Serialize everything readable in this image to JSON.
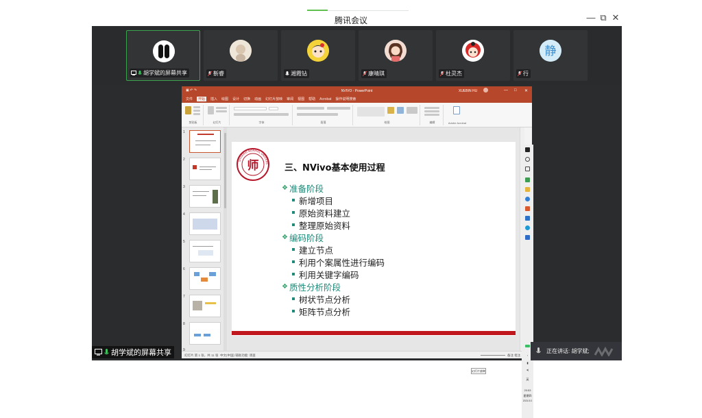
{
  "app": {
    "title": "腾讯会议",
    "controls": {
      "minimize": "—",
      "restore": "⧉",
      "close": "✕"
    }
  },
  "participants": [
    {
      "name": "胡学斌的屏幕共享",
      "icon": "screen-share-icon",
      "mic": "mic-on-icon",
      "avatar_color": "#1a1a1a"
    },
    {
      "name": "靳睿",
      "icon": "mic-muted-icon",
      "avatar_color": "#e8ddd0"
    },
    {
      "name": "湘霞钻",
      "icon": "mic-on-icon",
      "avatar_color": "#d9302c"
    },
    {
      "name": "康晴琪",
      "icon": "mic-muted-icon",
      "avatar_color": "#d98a7a"
    },
    {
      "name": "杜灵杰",
      "icon": "mic-muted-icon",
      "avatar_color": "#d92a2a"
    },
    {
      "name": "行",
      "icon": "mic-muted-icon",
      "avatar_color": "#cfe8f4"
    }
  ],
  "powerpoint": {
    "window_title": "NVIVO - PowerPoint",
    "user": "XUEBIN HU",
    "tabs": [
      "文件",
      "开始",
      "插入",
      "绘图",
      "设计",
      "切换",
      "动画",
      "幻灯片放映",
      "审阅",
      "视图",
      "帮助",
      "Acrobat",
      "操作说明搜索"
    ],
    "selected_tab": "开始",
    "ribbon_groups": [
      "剪贴板",
      "幻灯片",
      "字体",
      "段落",
      "绘图",
      "编辑",
      "Adobe Acrobat"
    ],
    "slide_count": 9,
    "status_left": "幻灯片 第 1 张，共 11 张",
    "status_center": "中文(中国)   辅助功能: 调查",
    "status_right": "备注   批注      107%",
    "tooltip": "幻灯片放映"
  },
  "slide": {
    "heading": "三、NVivo基本使用过程",
    "seal_text": "SHAANXI NORMAL UNIVERSITY",
    "seal_glyph": "师",
    "sections": [
      {
        "title": "准备阶段",
        "items": [
          "新增项目",
          "原始资料建立",
          "整理原始资料"
        ]
      },
      {
        "title": "编码阶段",
        "items": [
          "建立节点",
          "利用个案属性进行编码",
          "利用关键字编码"
        ]
      },
      {
        "title": "质性分析阶段",
        "items": [
          "树状节点分析",
          "矩阵节点分析"
        ]
      }
    ],
    "colors": {
      "heading": "#111111",
      "section": "#1f8a7a",
      "accent_bar": "#c0161e",
      "seal": "#b5162a"
    }
  },
  "taskbar": {
    "lang": "英",
    "time": "20:53",
    "day": "星期四",
    "date": "2021/1/1"
  },
  "share_label": "胡学斌的屏幕共享",
  "speaking": "正在讲话: 胡学斌;"
}
